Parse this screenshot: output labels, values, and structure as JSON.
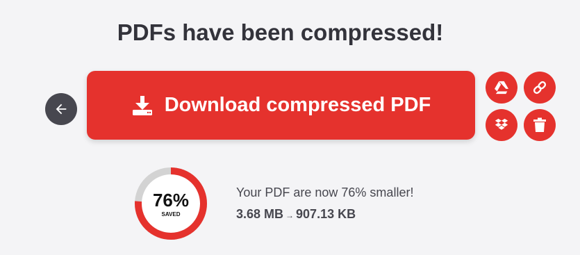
{
  "title": "PDFs have been compressed!",
  "download_label": "Download compressed PDF",
  "icons": {
    "back": "arrow-left-icon",
    "download": "download-icon",
    "drive": "google-drive-icon",
    "link": "link-icon",
    "dropbox": "dropbox-icon",
    "delete": "trash-icon"
  },
  "result": {
    "percent_text": "76%",
    "saved_label": "SAVED",
    "saved_fraction": 0.76,
    "message": "Your PDF are now 76% smaller!",
    "original_size": "3.68 MB",
    "arrow": "→",
    "new_size": "907.13 KB"
  },
  "colors": {
    "accent": "#e5322d",
    "back_button": "#47474f",
    "gauge_track": "#d3d3d3",
    "background": "#f4f4f6"
  }
}
